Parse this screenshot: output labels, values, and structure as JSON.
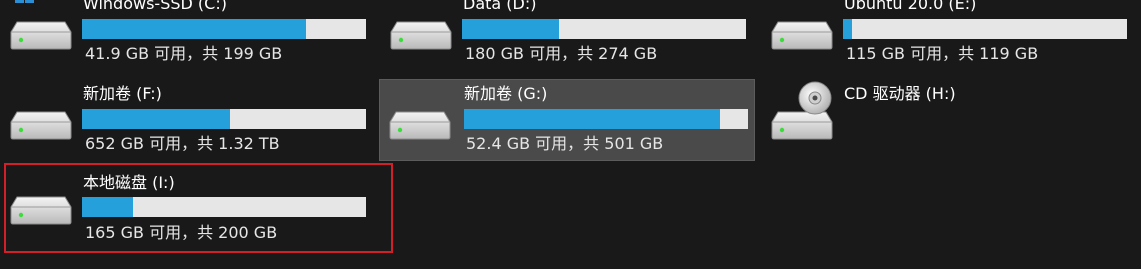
{
  "drives": [
    {
      "key": "c",
      "name": "Windows-SSD (C:)",
      "size_text": "41.9 GB 可用，共 199 GB",
      "used_fraction": 0.79,
      "icon": "windows-drive-icon"
    },
    {
      "key": "d",
      "name": "Data (D:)",
      "size_text": "180 GB 可用，共 274 GB",
      "used_fraction": 0.34,
      "icon": "hard-drive-icon"
    },
    {
      "key": "e",
      "name": "Ubuntu 20.0 (E:)",
      "size_text": "115 GB 可用，共 119 GB",
      "used_fraction": 0.03,
      "icon": "hard-drive-icon"
    },
    {
      "key": "f",
      "name": "新加卷 (F:)",
      "size_text": "652 GB 可用，共 1.32 TB",
      "used_fraction": 0.52,
      "icon": "hard-drive-icon"
    },
    {
      "key": "g",
      "name": "新加卷 (G:)",
      "size_text": "52.4 GB 可用，共 501 GB",
      "used_fraction": 0.9,
      "icon": "hard-drive-icon"
    },
    {
      "key": "h",
      "name": "CD 驱动器 (H:)",
      "size_text": "",
      "used_fraction": null,
      "icon": "cd-drive-icon"
    },
    {
      "key": "i",
      "name": "本地磁盘 (I:)",
      "size_text": "165 GB 可用，共 200 GB",
      "used_fraction": 0.18,
      "icon": "hard-drive-icon"
    }
  ],
  "colors": {
    "background": "#191919",
    "bar_fill": "#26a0da",
    "bar_track": "#e6e6e6",
    "selected_bg": "#4a4a4a",
    "focus_outline": "#d21f2a",
    "led": "#3ddc3d"
  }
}
